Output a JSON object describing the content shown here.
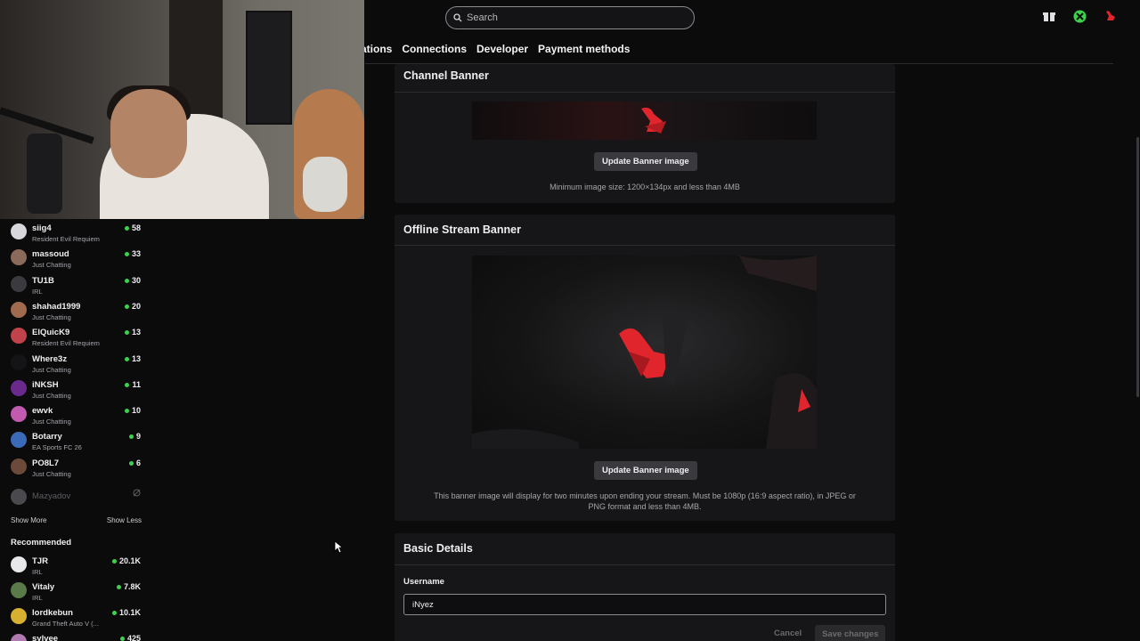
{
  "search": {
    "placeholder": "Search"
  },
  "top_icons": [
    "gift-icon",
    "xbox-icon",
    "user-avatar-icon"
  ],
  "tabs": [
    "ations",
    "Connections",
    "Developer",
    "Payment methods"
  ],
  "sidebar": {
    "channels": [
      {
        "name": "siig4",
        "category": "Resident Evil Requiem",
        "viewers": "58",
        "avatar_color": "#d8d8dc"
      },
      {
        "name": "massoud",
        "category": "Just Chatting",
        "viewers": "33",
        "avatar_color": "#8a6a5a"
      },
      {
        "name": "TU1B",
        "category": "IRL",
        "viewers": "30",
        "avatar_color": "#3b3b3f"
      },
      {
        "name": "shahad1999",
        "category": "Just Chatting",
        "viewers": "20",
        "avatar_color": "#a06a4e"
      },
      {
        "name": "ElQuicK9",
        "category": "Resident Evil Requiem",
        "viewers": "13",
        "avatar_color": "#c0424a"
      },
      {
        "name": "Where3z",
        "category": "Just Chatting",
        "viewers": "13",
        "avatar_color": "#141416"
      },
      {
        "name": "iNKSH",
        "category": "Just Chatting",
        "viewers": "11",
        "avatar_color": "#6a2a8c"
      },
      {
        "name": "ewvk",
        "category": "Just Chatting",
        "viewers": "10",
        "avatar_color": "#c25ab0"
      },
      {
        "name": "Botarry",
        "category": "EA Sports FC 26",
        "viewers": "9",
        "avatar_color": "#3a6ab8"
      },
      {
        "name": "PO8L7",
        "category": "Just Chatting",
        "viewers": "6",
        "avatar_color": "#6b4a3a"
      }
    ],
    "offline_channel": {
      "name": "Mazyadov",
      "avatar_color": "#4a4a4e"
    },
    "show_more": "Show More",
    "show_less": "Show Less",
    "recommended_title": "Recommended",
    "recommended": [
      {
        "name": "TJR",
        "category": "IRL",
        "viewers": "20.1K",
        "avatar_color": "#e8e8ea"
      },
      {
        "name": "Vitaly",
        "category": "IRL",
        "viewers": "7.8K",
        "avatar_color": "#5a7a4a"
      },
      {
        "name": "lordkebun",
        "category": "Grand Theft Auto V (...",
        "viewers": "10.1K",
        "avatar_color": "#d8b030"
      },
      {
        "name": "sylvee",
        "category": "",
        "viewers": "425",
        "avatar_color": "#b07ab0"
      }
    ]
  },
  "channel_banner": {
    "title": "Channel Banner",
    "button": "Update Banner image",
    "hint": "Minimum image size: 1200×134px and less than 4MB"
  },
  "offline_banner": {
    "title": "Offline Stream Banner",
    "button": "Update Banner image",
    "hint_line1": "This banner image will display for two minutes upon ending your stream. Must be 1080p (16:9 aspect ratio), in JPEG or",
    "hint_line2": "PNG format and less than 4MB."
  },
  "basic_details": {
    "title": "Basic Details",
    "username_label": "Username",
    "username_value": "iNyez",
    "cancel": "Cancel",
    "save": "Save changes"
  },
  "colors": {
    "accent_red": "#e0262c",
    "live_green": "#3ed14e",
    "card_bg": "#161618"
  }
}
